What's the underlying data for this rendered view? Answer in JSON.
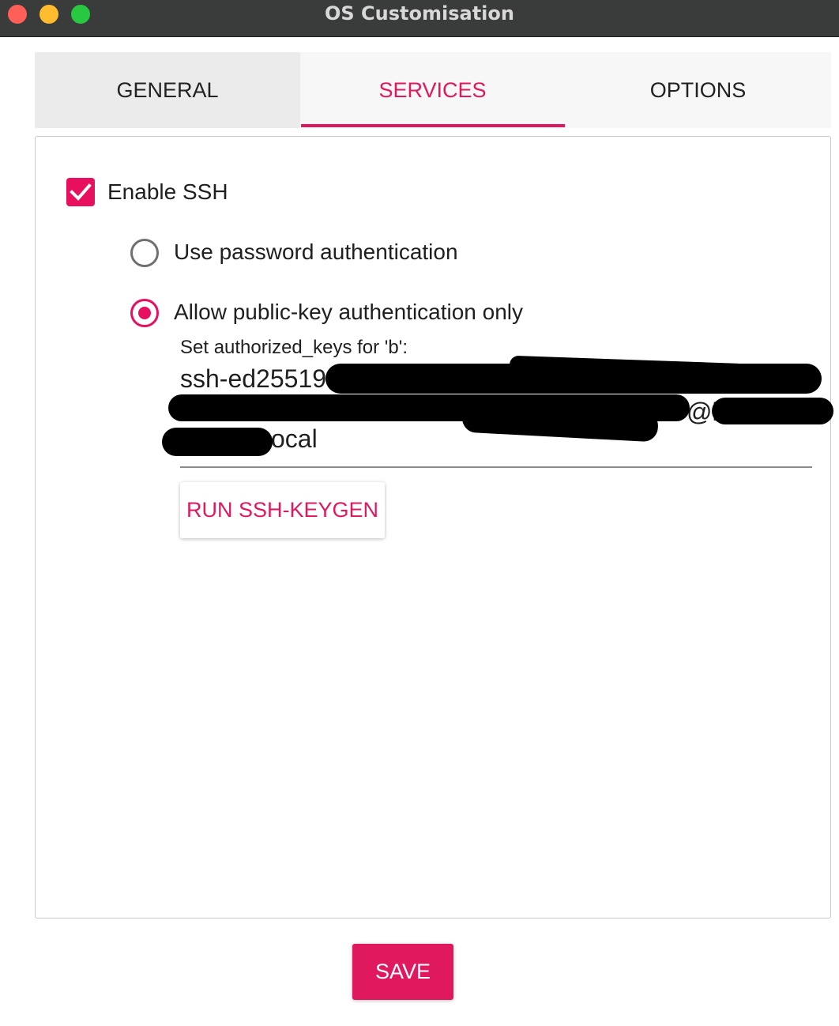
{
  "window": {
    "title": "OS Customisation",
    "controls": [
      "close",
      "minimize",
      "zoom"
    ]
  },
  "tabs": [
    {
      "label": "GENERAL",
      "selected": false
    },
    {
      "label": "SERVICES",
      "selected": true
    },
    {
      "label": "OPTIONS",
      "selected": false
    }
  ],
  "services": {
    "enable_ssh": {
      "label": "Enable SSH",
      "checked": true
    },
    "auth_options": [
      {
        "label": "Use password authentication",
        "selected": false
      },
      {
        "label": "Allow public-key authentication only",
        "selected": true
      }
    ],
    "authorized_keys": {
      "label": "Set authorized_keys for 'b':",
      "visible_fragments": [
        "ssh-ed25519",
        "@l",
        "ocal"
      ],
      "redacted": true
    },
    "keygen_button": "RUN SSH-KEYGEN"
  },
  "save_button": "SAVE",
  "colors": {
    "accent": "#e0195f",
    "titlebar": "#3a3b3b",
    "close": "#fe5f57",
    "minimize": "#febc2e",
    "zoom": "#28c840"
  }
}
